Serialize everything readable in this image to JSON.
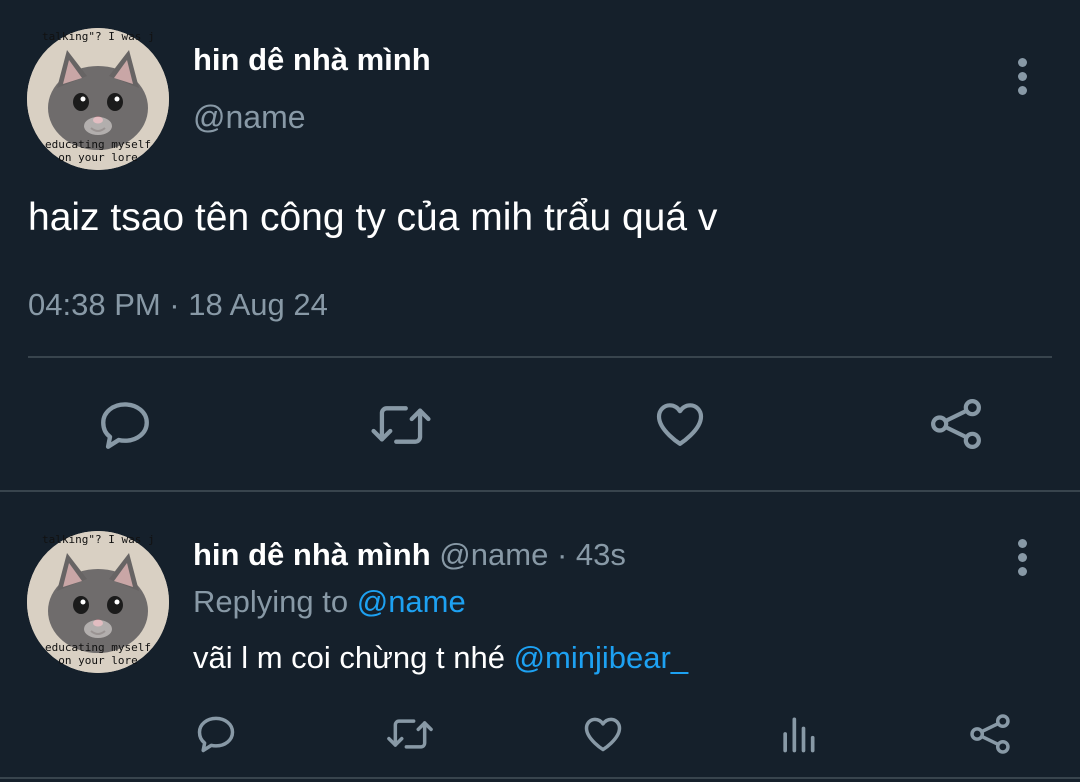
{
  "main_tweet": {
    "avatar_caption_top": "talking\"? I was just",
    "avatar_caption_bottom": "educating myself on your lore",
    "display_name": "hin dê nhà mình",
    "handle": "@name",
    "text": "haiz tsao tên công ty của mih trẩu quá v",
    "timestamp": "04:38 PM · 18 Aug 24",
    "actions": [
      "reply-icon",
      "retweet-icon",
      "like-icon",
      "share-icon"
    ]
  },
  "reply_tweet": {
    "avatar_caption_top": "talking\"? I was just",
    "avatar_caption_bottom": "educating myself on your lore",
    "display_name": "hin dê nhà mình",
    "handle": "@name",
    "time_ago": "· 43s",
    "replying_to_label": "Replying to",
    "replying_to_handle": "@name",
    "text": "vãi l m coi chừng t nhé",
    "mention": "@minjibear_",
    "actions": [
      "reply-icon",
      "retweet-icon",
      "like-icon",
      "analytics-icon",
      "share-icon"
    ]
  },
  "colors": {
    "background": "#15202b",
    "text": "#ffffff",
    "muted": "#8899a6",
    "link": "#1da1f2",
    "divider": "#38444d"
  }
}
